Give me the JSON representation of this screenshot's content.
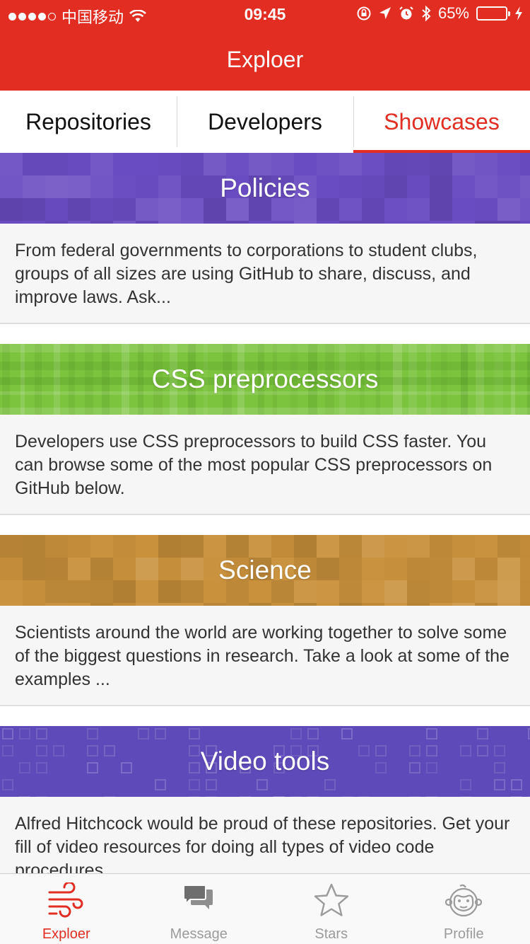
{
  "status_bar": {
    "carrier": "中国移动",
    "time": "09:45",
    "battery": "65%",
    "battery_level": 0.65
  },
  "nav": {
    "title": "Exploer"
  },
  "tabs": [
    {
      "label": "Repositories"
    },
    {
      "label": "Developers"
    },
    {
      "label": "Showcases",
      "active": true
    }
  ],
  "showcases": [
    {
      "title": "Policies",
      "description": "From federal governments to corporations to student clubs, groups of all sizes are using GitHub to share, discuss, and improve laws.  Ask...",
      "color": "#6a4cc2"
    },
    {
      "title": "CSS preprocessors",
      "description": "Developers use CSS preprocessors to build CSS faster. You can browse some of the most popular CSS preprocessors on GitHub below.",
      "color": "#7cc43e"
    },
    {
      "title": "Science",
      "description": "Scientists around the world are working together to solve some of the biggest questions in research. Take a look at some of the examples ...",
      "color": "#c9913c"
    },
    {
      "title": "Video tools",
      "description": "Alfred Hitchcock would be proud of these repositories. Get your fill of video resources for doing all types of video code procedures...",
      "color": "#5e4ab8"
    }
  ],
  "tabbar": [
    {
      "label": "Exploer",
      "icon": "wind-icon",
      "active": true
    },
    {
      "label": "Message",
      "icon": "chat-bubbles-icon"
    },
    {
      "label": "Stars",
      "icon": "star-icon"
    },
    {
      "label": "Profile",
      "icon": "monkey-face-icon"
    }
  ],
  "colors": {
    "accent": "#e22d22",
    "inactive": "#9b9b9b"
  }
}
